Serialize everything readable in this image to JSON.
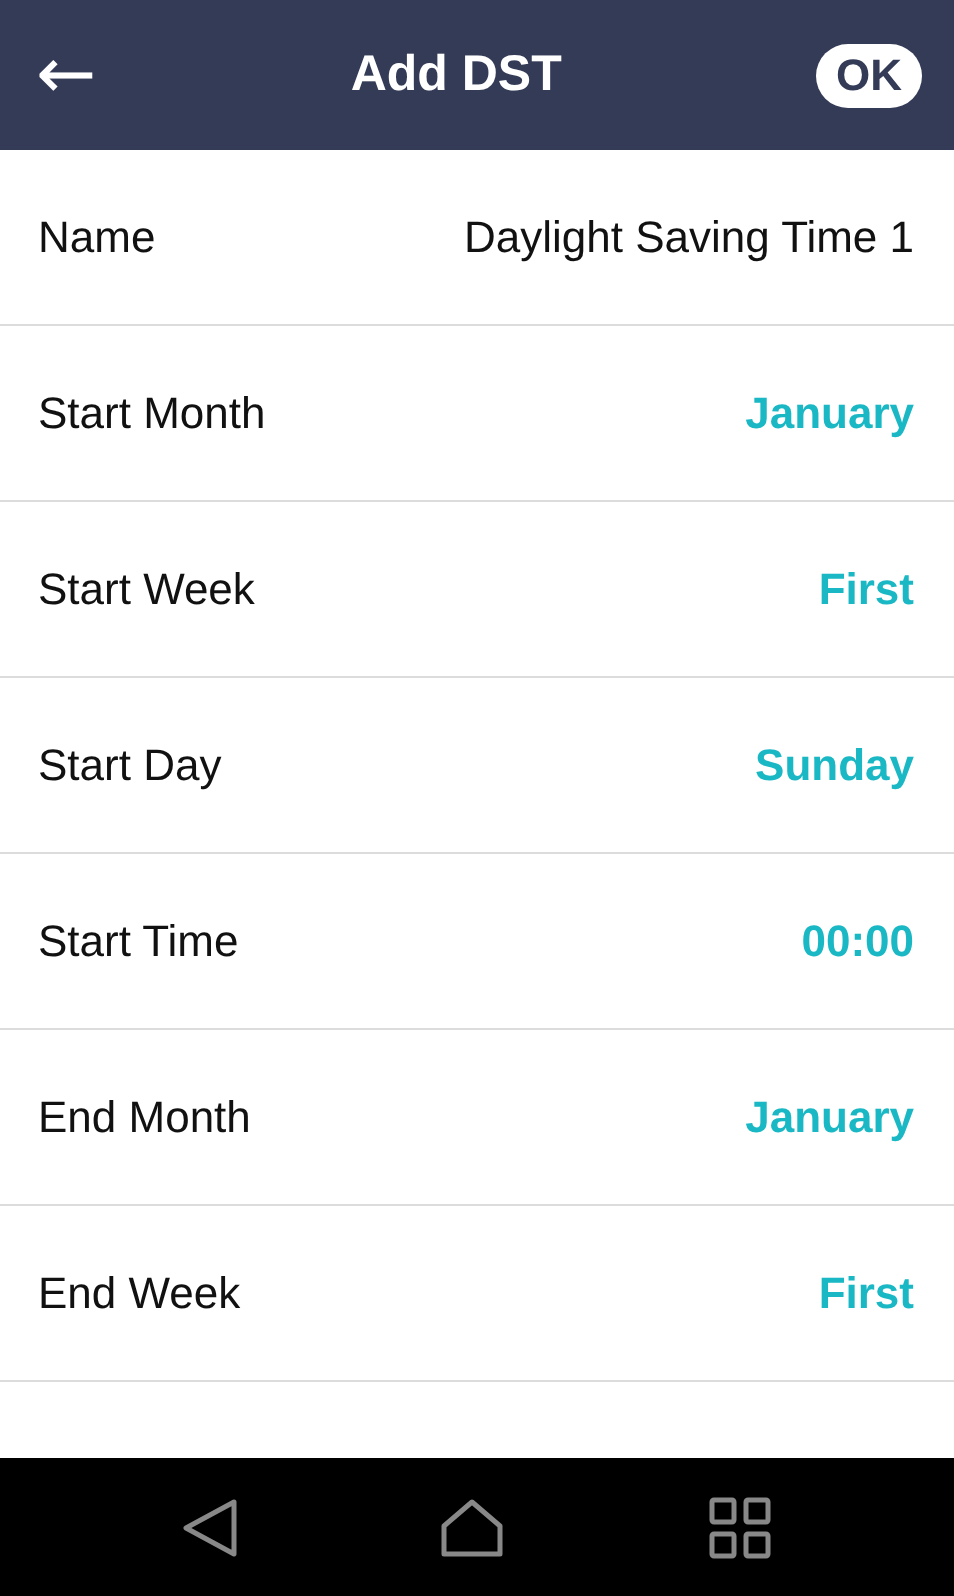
{
  "header": {
    "back": "←",
    "title": "Add DST",
    "ok": "OK"
  },
  "rows": [
    {
      "label": "Name",
      "value": "Daylight Saving Time 1",
      "kind": "text"
    },
    {
      "label": "Start Month",
      "value": "January",
      "kind": "select"
    },
    {
      "label": "Start Week",
      "value": "First",
      "kind": "select"
    },
    {
      "label": "Start Day",
      "value": "Sunday",
      "kind": "select"
    },
    {
      "label": "Start Time",
      "value": "00:00",
      "kind": "select"
    },
    {
      "label": "End Month",
      "value": "January",
      "kind": "select"
    },
    {
      "label": "End Week",
      "value": "First",
      "kind": "select"
    }
  ]
}
